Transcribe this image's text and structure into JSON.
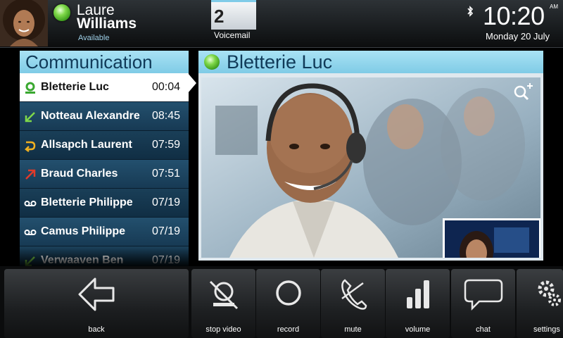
{
  "user": {
    "first_name": "Laure",
    "last_name": "Williams",
    "status": "Available"
  },
  "voicemail": {
    "count": "2",
    "label": "Voicemail"
  },
  "clock": {
    "time": "10:20",
    "ampm": "AM",
    "date": "Monday 20 July"
  },
  "communication": {
    "title": "Communication",
    "items": [
      {
        "name": "Bletterie Luc",
        "time": "00:04",
        "icon": "presence-person-icon",
        "icon_color": "#3aa830",
        "active": true
      },
      {
        "name": "Notteau Alexandre",
        "time": "08:45",
        "icon": "incoming-call-icon",
        "icon_color": "#7fd84a"
      },
      {
        "name": "Allsapch Laurent",
        "time": "07:59",
        "icon": "missed-call-icon",
        "icon_color": "#f0b020"
      },
      {
        "name": "Braud Charles",
        "time": "07:51",
        "icon": "outgoing-call-icon",
        "icon_color": "#e03a2a"
      },
      {
        "name": "Bletterie Philippe",
        "time": "07/19",
        "icon": "voicemail-icon",
        "icon_color": "#ffffff"
      },
      {
        "name": "Camus Philippe",
        "time": "07/19",
        "icon": "voicemail-icon",
        "icon_color": "#ffffff"
      },
      {
        "name": "Verwaaven Ben",
        "time": "07/19",
        "icon": "incoming-call-icon",
        "icon_color": "#7fd84a"
      }
    ]
  },
  "contact": {
    "name": "Bletterie Luc"
  },
  "toolbar": {
    "back": "back",
    "stop_video": "stop video",
    "record": "record",
    "mute": "mute",
    "volume": "volume",
    "chat": "chat",
    "settings": "settings"
  },
  "colors": {
    "accent": "#7fcbe6",
    "presence_green": "#5ac02a",
    "panel_dark": "#0f2d44"
  }
}
